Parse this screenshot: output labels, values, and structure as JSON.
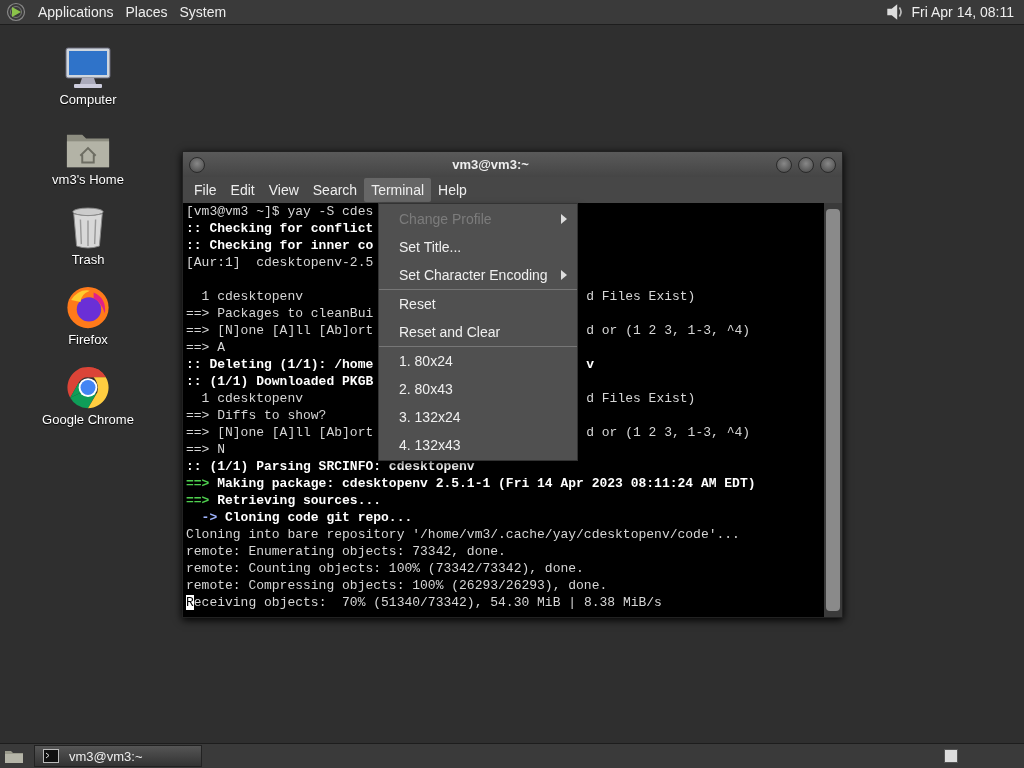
{
  "top_panel": {
    "menus": [
      "Applications",
      "Places",
      "System"
    ],
    "clock": "Fri Apr 14, 08:11"
  },
  "desktop_icons": [
    {
      "label": "Computer",
      "kind": "computer"
    },
    {
      "label": "vm3's Home",
      "kind": "home"
    },
    {
      "label": "Trash",
      "kind": "trash"
    },
    {
      "label": "Firefox",
      "kind": "firefox"
    },
    {
      "label": "Google Chrome",
      "kind": "chrome"
    }
  ],
  "window": {
    "title": "vm3@vm3:~",
    "menu": [
      {
        "label": "File",
        "selected": false
      },
      {
        "label": "Edit",
        "selected": false
      },
      {
        "label": "View",
        "selected": false
      },
      {
        "label": "Search",
        "selected": false
      },
      {
        "label": "Terminal",
        "selected": true
      },
      {
        "label": "Help",
        "selected": false
      }
    ],
    "terminal": {
      "lines": [
        {
          "kind": "text",
          "segments": [
            {
              "text": "[vm3@vm3 ~]$ yay -S cdes",
              "kind": "plain"
            }
          ]
        },
        {
          "kind": "text",
          "segments": [
            {
              "text": ":: Checking for conflict",
              "kind": "bold"
            }
          ]
        },
        {
          "kind": "text",
          "segments": [
            {
              "text": ":: Checking for inner co",
              "kind": "bold"
            }
          ]
        },
        {
          "kind": "text",
          "segments": [
            {
              "text": "[Aur:1]  cdesktopenv-2.5",
              "kind": "plain"
            }
          ]
        },
        {
          "kind": "blank"
        },
        {
          "kind": "text",
          "segments": [
            {
              "text": "  1 cdesktopenv",
              "kind": "plain"
            }
          ],
          "tail": [
            {
              "text": "d Files Exist)",
              "kind": "plain"
            }
          ]
        },
        {
          "kind": "text",
          "segments": [
            {
              "text": "==> Packages to cleanBui",
              "kind": "plain"
            }
          ]
        },
        {
          "kind": "text",
          "segments": [
            {
              "text": "==> [N]one [A]ll [Ab]ort",
              "kind": "plain"
            }
          ],
          "tail": [
            {
              "text": "d or (1 2 3, 1-3, ^4)",
              "kind": "plain"
            }
          ]
        },
        {
          "kind": "text",
          "segments": [
            {
              "text": "==> A",
              "kind": "plain"
            }
          ]
        },
        {
          "kind": "text",
          "segments": [
            {
              "text": ":: Deleting (1/1): /home",
              "kind": "bold"
            }
          ],
          "tail": [
            {
              "text": "v",
              "kind": "bold"
            }
          ]
        },
        {
          "kind": "text",
          "segments": [
            {
              "text": ":: (1/1) Downloaded PKGB",
              "kind": "bold"
            }
          ]
        },
        {
          "kind": "text",
          "segments": [
            {
              "text": "  1 cdesktopenv",
              "kind": "plain"
            }
          ],
          "tail": [
            {
              "text": "d Files Exist)",
              "kind": "plain"
            }
          ]
        },
        {
          "kind": "text",
          "segments": [
            {
              "text": "==> Diffs to show?",
              "kind": "plain"
            }
          ]
        },
        {
          "kind": "text",
          "segments": [
            {
              "text": "==> [N]one [A]ll [Ab]ort",
              "kind": "plain"
            }
          ],
          "tail": [
            {
              "text": "d or (1 2 3, 1-3, ^4)",
              "kind": "plain"
            }
          ]
        },
        {
          "kind": "text",
          "segments": [
            {
              "text": "==> N",
              "kind": "plain"
            }
          ]
        },
        {
          "kind": "text",
          "segments": [
            {
              "text": ":: (1/1) Parsing SRCINFO: cdesktopenv",
              "kind": "bold"
            }
          ]
        },
        {
          "kind": "text",
          "segments": [
            {
              "text": "==>",
              "kind": "bold",
              "color": "#4fd14f"
            },
            {
              "text": " Making package: cdesktopenv 2.5.1-1 (Fri 14 Apr 2023 08:11:24 AM EDT)",
              "kind": "bold"
            }
          ]
        },
        {
          "kind": "text",
          "segments": [
            {
              "text": "==>",
              "kind": "bold",
              "color": "#4fd14f"
            },
            {
              "text": " Retrieving sources...",
              "kind": "bold"
            }
          ]
        },
        {
          "kind": "text",
          "segments": [
            {
              "text": "  ->",
              "kind": "bold",
              "color": "#9fb4ff"
            },
            {
              "text": " Cloning code git repo...",
              "kind": "bold"
            }
          ]
        },
        {
          "kind": "text",
          "segments": [
            {
              "text": "Cloning into bare repository '/home/vm3/.cache/yay/cdesktopenv/code'...",
              "kind": "plain"
            }
          ]
        },
        {
          "kind": "text",
          "segments": [
            {
              "text": "remote: Enumerating objects: 73342, done.",
              "kind": "plain"
            }
          ]
        },
        {
          "kind": "text",
          "segments": [
            {
              "text": "remote: Counting objects: 100% (73342/73342), done.",
              "kind": "plain"
            }
          ]
        },
        {
          "kind": "text",
          "segments": [
            {
              "text": "remote: Compressing objects: 100% (26293/26293), done.",
              "kind": "plain"
            }
          ]
        },
        {
          "kind": "text",
          "segments": [
            {
              "text": "R",
              "kind": "cursor"
            },
            {
              "text": "eceiving objects:  70% (51340/73342), 54.30 MiB | 8.38 MiB/s",
              "kind": "plain"
            }
          ]
        }
      ]
    },
    "open_menu": {
      "items": [
        {
          "kind": "item",
          "label": "Change Profile",
          "disabled": true,
          "submenu": true
        },
        {
          "kind": "item",
          "label": "Set Title...",
          "disabled": false,
          "submenu": false
        },
        {
          "kind": "item",
          "label": "Set Character Encoding",
          "disabled": false,
          "submenu": true
        },
        {
          "kind": "separator"
        },
        {
          "kind": "item",
          "label": "Reset",
          "disabled": false,
          "submenu": false
        },
        {
          "kind": "item",
          "label": "Reset and Clear",
          "disabled": false,
          "submenu": false
        },
        {
          "kind": "separator"
        },
        {
          "kind": "item",
          "label": "1. 80x24",
          "disabled": false,
          "submenu": false
        },
        {
          "kind": "item",
          "label": "2. 80x43",
          "disabled": false,
          "submenu": false
        },
        {
          "kind": "item",
          "label": "3. 132x24",
          "disabled": false,
          "submenu": false
        },
        {
          "kind": "item",
          "label": "4. 132x43",
          "disabled": false,
          "submenu": false
        }
      ]
    }
  },
  "taskbar": {
    "tasks": [
      {
        "label": "vm3@vm3:~",
        "selected": true
      }
    ]
  }
}
